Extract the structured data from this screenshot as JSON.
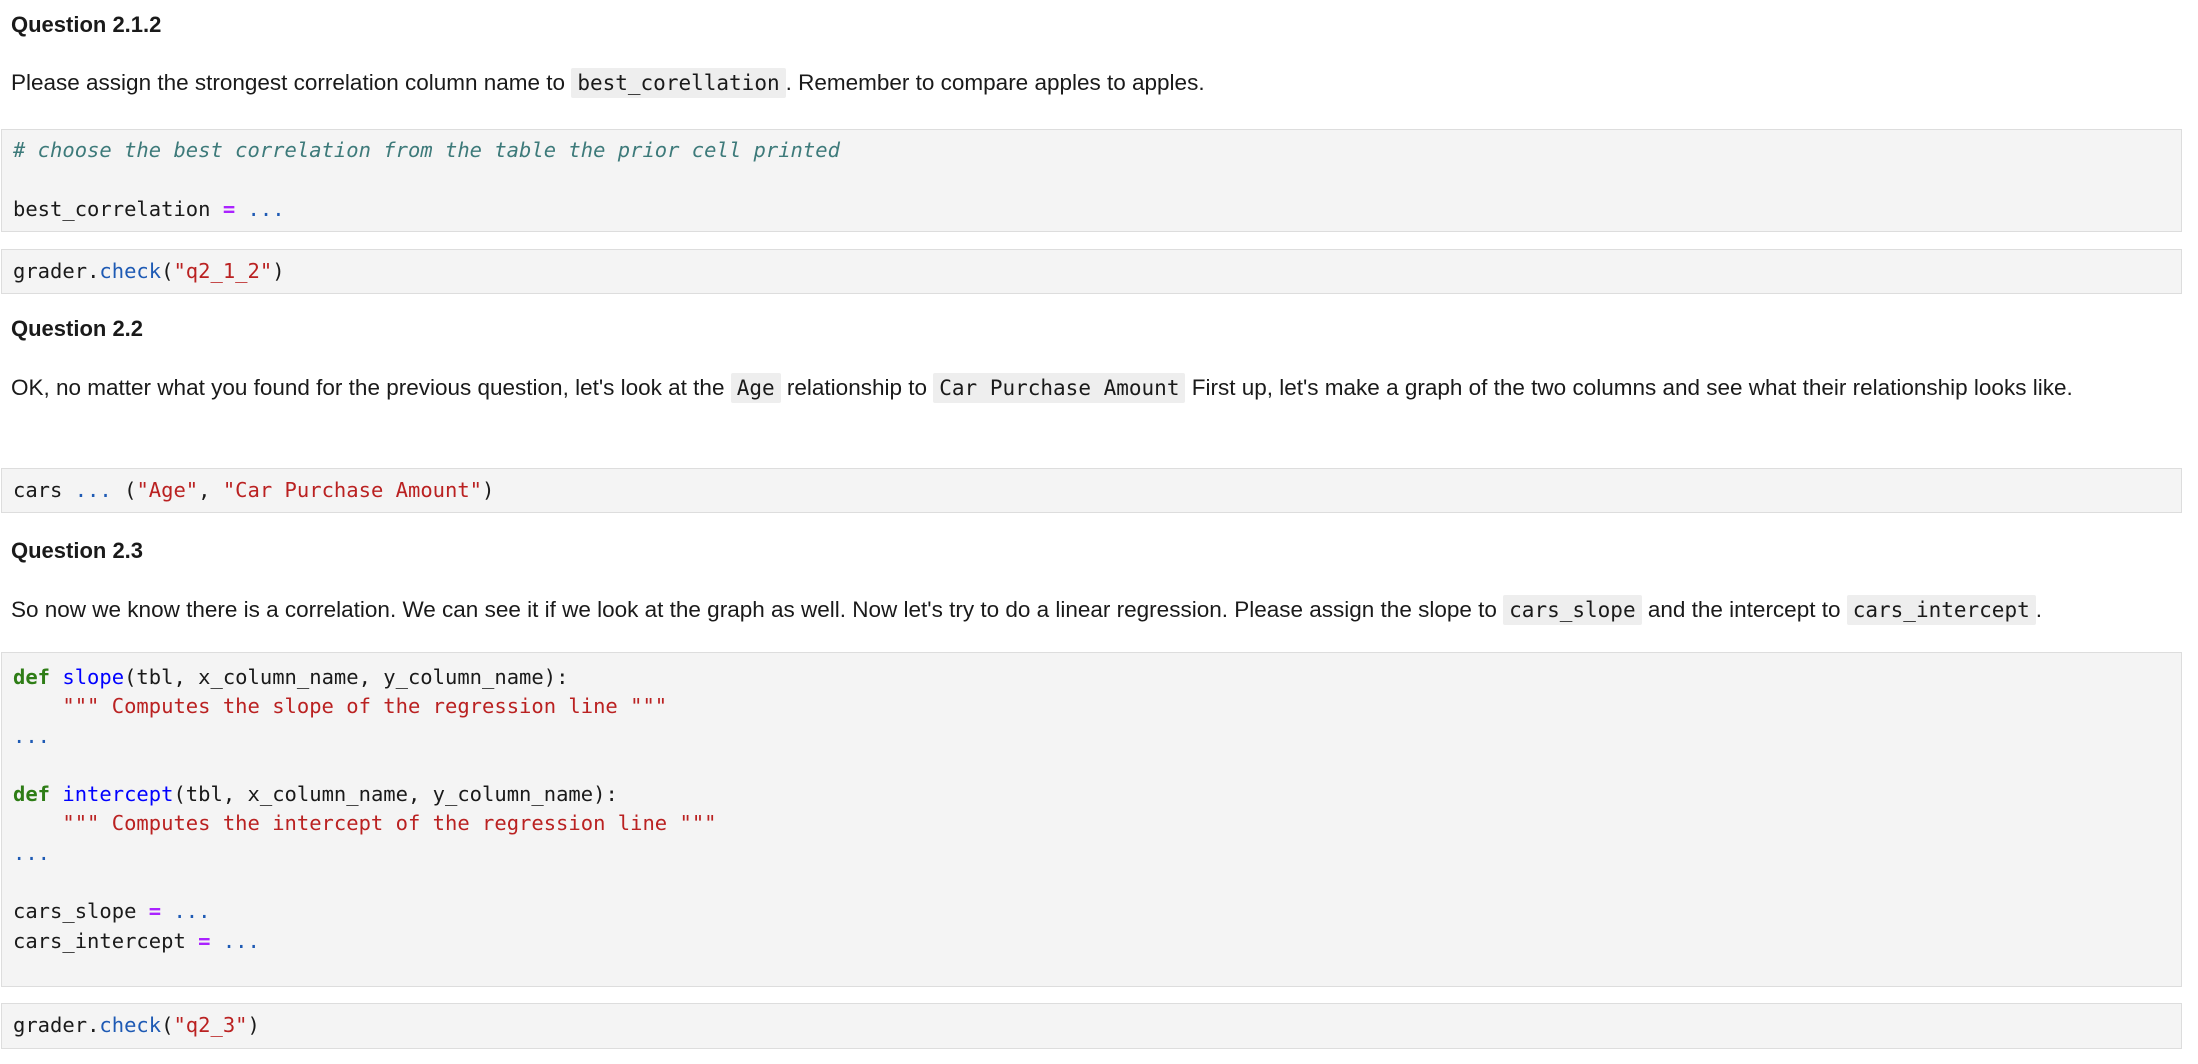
{
  "q212": {
    "heading": "Question 2.1.2",
    "para": {
      "before": "Please assign the strongest correlation column name to ",
      "code1": "best_corellation",
      "after": ". Remember to compare apples to apples."
    },
    "cell1": {
      "comment": "# choose the best correlation from the table the prior cell printed",
      "var": "best_correlation",
      "op": "=",
      "ellipsis": "..."
    },
    "cell2": {
      "obj": "grader",
      "dot": ".",
      "method": "check",
      "open": "(",
      "arg": "\"q2_1_2\"",
      "close": ")"
    }
  },
  "q22": {
    "heading": "Question 2.2",
    "para": {
      "before": "OK, no matter what you found for the previous question, let's look at the ",
      "code1": "Age",
      "middle": " relationship to ",
      "code2": "Car Purchase Amount",
      "after": " First up, let's make a graph of the two columns and see what their relationship looks like."
    },
    "cell3": {
      "var": "cars",
      "ellipsis": "...",
      "open": " (",
      "arg1": "\"Age\"",
      "sep": ", ",
      "arg2": "\"Car Purchase Amount\"",
      "close": ")"
    }
  },
  "q23": {
    "heading": "Question 2.3",
    "para": {
      "before": "So now we know there is a correlation. We can see it if we look at the graph as well. Now let's try to do a linear regression. Please assign the slope to ",
      "code1": "cars_slope",
      "middle": " and the intercept to ",
      "code2": "cars_intercept",
      "after": "."
    },
    "cell4": {
      "def_kw": "def",
      "slope_fn": "slope",
      "slope_args": "(tbl, x_column_name, y_column_name):",
      "slope_doc": "\"\"\" Computes the slope of the regression line \"\"\"",
      "intercept_fn": "intercept",
      "intercept_args": "(tbl, x_column_name, y_column_name):",
      "intercept_doc": "\"\"\" Computes the intercept of the regression line \"\"\"",
      "ellipsis": "...",
      "slope_var": "cars_slope",
      "intercept_var": "cars_intercept",
      "op": "="
    },
    "cell5": {
      "obj": "grader",
      "dot": ".",
      "method": "check",
      "open": "(",
      "arg": "\"q2_3\"",
      "close": ")"
    }
  }
}
